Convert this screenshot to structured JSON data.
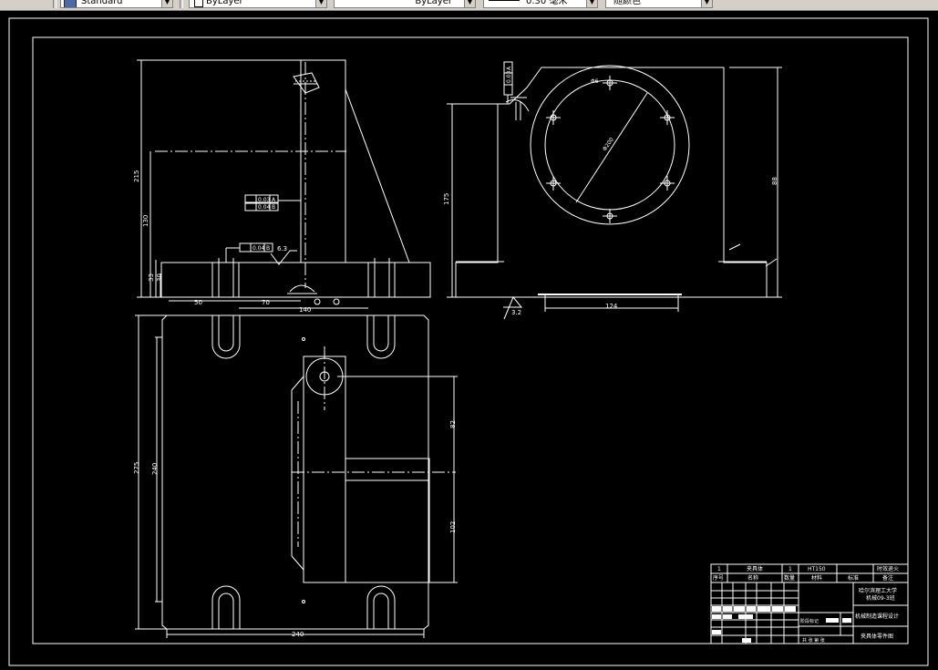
{
  "toolbar": {
    "text_style": "Standard",
    "layer": "ByLayer",
    "linetype": "ByLayer",
    "lineweight": "0.30 毫米",
    "plot_style": "随颜色"
  },
  "colors": {
    "canvas": "#000000",
    "lines": "#ffffff",
    "toolbar": "#d4d0c8"
  },
  "dims": {
    "d140": "140",
    "d50": "50",
    "d70": "70",
    "d215": "215",
    "d130": "130",
    "d33": "33",
    "d30": "30",
    "d175": "175",
    "d124": "124",
    "d88": "88",
    "d275": "275",
    "d240v": "240",
    "d82": "82",
    "d102": "102",
    "d240h": "240",
    "circle_dia": "Φ200",
    "bolt": "Φ6"
  },
  "gdt": {
    "parallel": "0.03",
    "ref_a": "A",
    "perp1": "0.04",
    "ref_b": "B",
    "perp2": "0.04",
    "ref_b2": "B",
    "right_box": "0.03",
    "right_ref": "A"
  },
  "roughness": {
    "r1": "6.3",
    "r2": "3.2"
  },
  "title_block": {
    "row1": [
      "1",
      "夹具体",
      "1",
      "HT150",
      "",
      "时效退火"
    ],
    "headers": [
      "序号",
      "名称",
      "数量",
      "材料",
      "标准",
      "备注"
    ],
    "school_1": "哈尔滨理工大学",
    "school_2": "机械09-3班",
    "project": "机械制造课程设计",
    "stage_label": "阶段标记",
    "scale_label": "比例",
    "sheet_label": "共  张 第  张",
    "drawing_name": "夹具体零件图"
  }
}
